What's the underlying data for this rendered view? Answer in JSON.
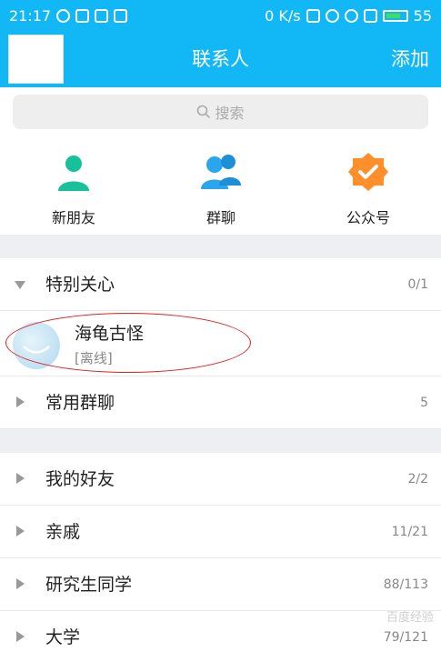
{
  "status_bar": {
    "time": "21:17",
    "net_speed": "0 K/s",
    "battery": "55"
  },
  "header": {
    "title": "联系人",
    "add_label": "添加"
  },
  "search": {
    "placeholder": "搜索"
  },
  "shortcuts": [
    {
      "label": "新朋友",
      "icon": "new-friend-icon",
      "color": "#17c29a"
    },
    {
      "label": "群聊",
      "icon": "group-chat-icon",
      "color": "#2aa6ee"
    },
    {
      "label": "公众号",
      "icon": "official-account-icon",
      "color": "#ff8f2a"
    }
  ],
  "groups": [
    {
      "label": "特别关心",
      "count": "0/1",
      "expanded": true
    },
    {
      "label": "常用群聊",
      "count": "5",
      "expanded": false
    },
    {
      "label": "我的好友",
      "count": "2/2",
      "expanded": false
    },
    {
      "label": "亲戚",
      "count": "11/21",
      "expanded": false
    },
    {
      "label": "研究生同学",
      "count": "88/113",
      "expanded": false
    },
    {
      "label": "大学",
      "count": "79/121",
      "expanded": false
    }
  ],
  "contact": {
    "name": "海龟古怪",
    "status": "[离线]"
  },
  "watermark": "百度经验",
  "colors": {
    "accent": "#12b7f5",
    "highlight_ellipse": "#e02222"
  }
}
